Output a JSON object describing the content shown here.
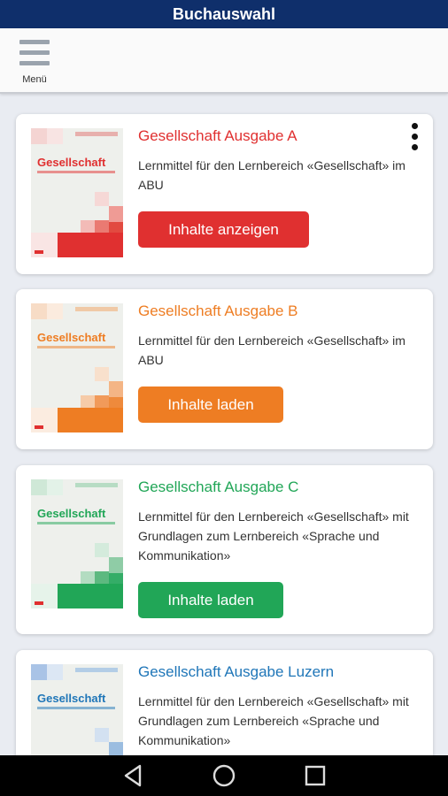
{
  "titlebar": {
    "title": "Buchauswahl"
  },
  "toolbar": {
    "menu_label": "Menü",
    "menu_icon": "hamburger-menu-icon"
  },
  "books": [
    {
      "title": "Gesellschaft Ausgabe A",
      "description": "Lernmittel für den Lernbereich «Gesellschaft» im ABU",
      "button_label": "Inhalte anzeigen",
      "color": "#e03030",
      "cover_title": "Gesellschaft",
      "has_more_menu": true
    },
    {
      "title": "Gesellschaft Ausgabe B",
      "description": "Lernmittel für den Lernbereich «Gesellschaft» im ABU",
      "button_label": "Inhalte laden",
      "color": "#ee7d23",
      "cover_title": "Gesellschaft",
      "has_more_menu": false
    },
    {
      "title": "Gesellschaft Ausgabe C",
      "description": "Lernmittel für den Lernbereich «Gesellschaft» mit Grundlagen zum Lernbereich «Sprache und Kommunikation»",
      "button_label": "Inhalte laden",
      "color": "#21a657",
      "cover_title": "Gesellschaft",
      "has_more_menu": false
    },
    {
      "title": "Gesellschaft Ausgabe Luzern",
      "description": "Lernmittel für den Lernbereich «Gesellschaft» mit Grundlagen zum Lernbereich «Sprache und Kommunikation»",
      "button_label": "",
      "color": "#1f76b8",
      "cover_title": "Gesellschaft",
      "has_more_menu": false
    }
  ],
  "navbar": {
    "icons": [
      "back-triangle-icon",
      "home-circle-icon",
      "recents-square-icon"
    ]
  }
}
